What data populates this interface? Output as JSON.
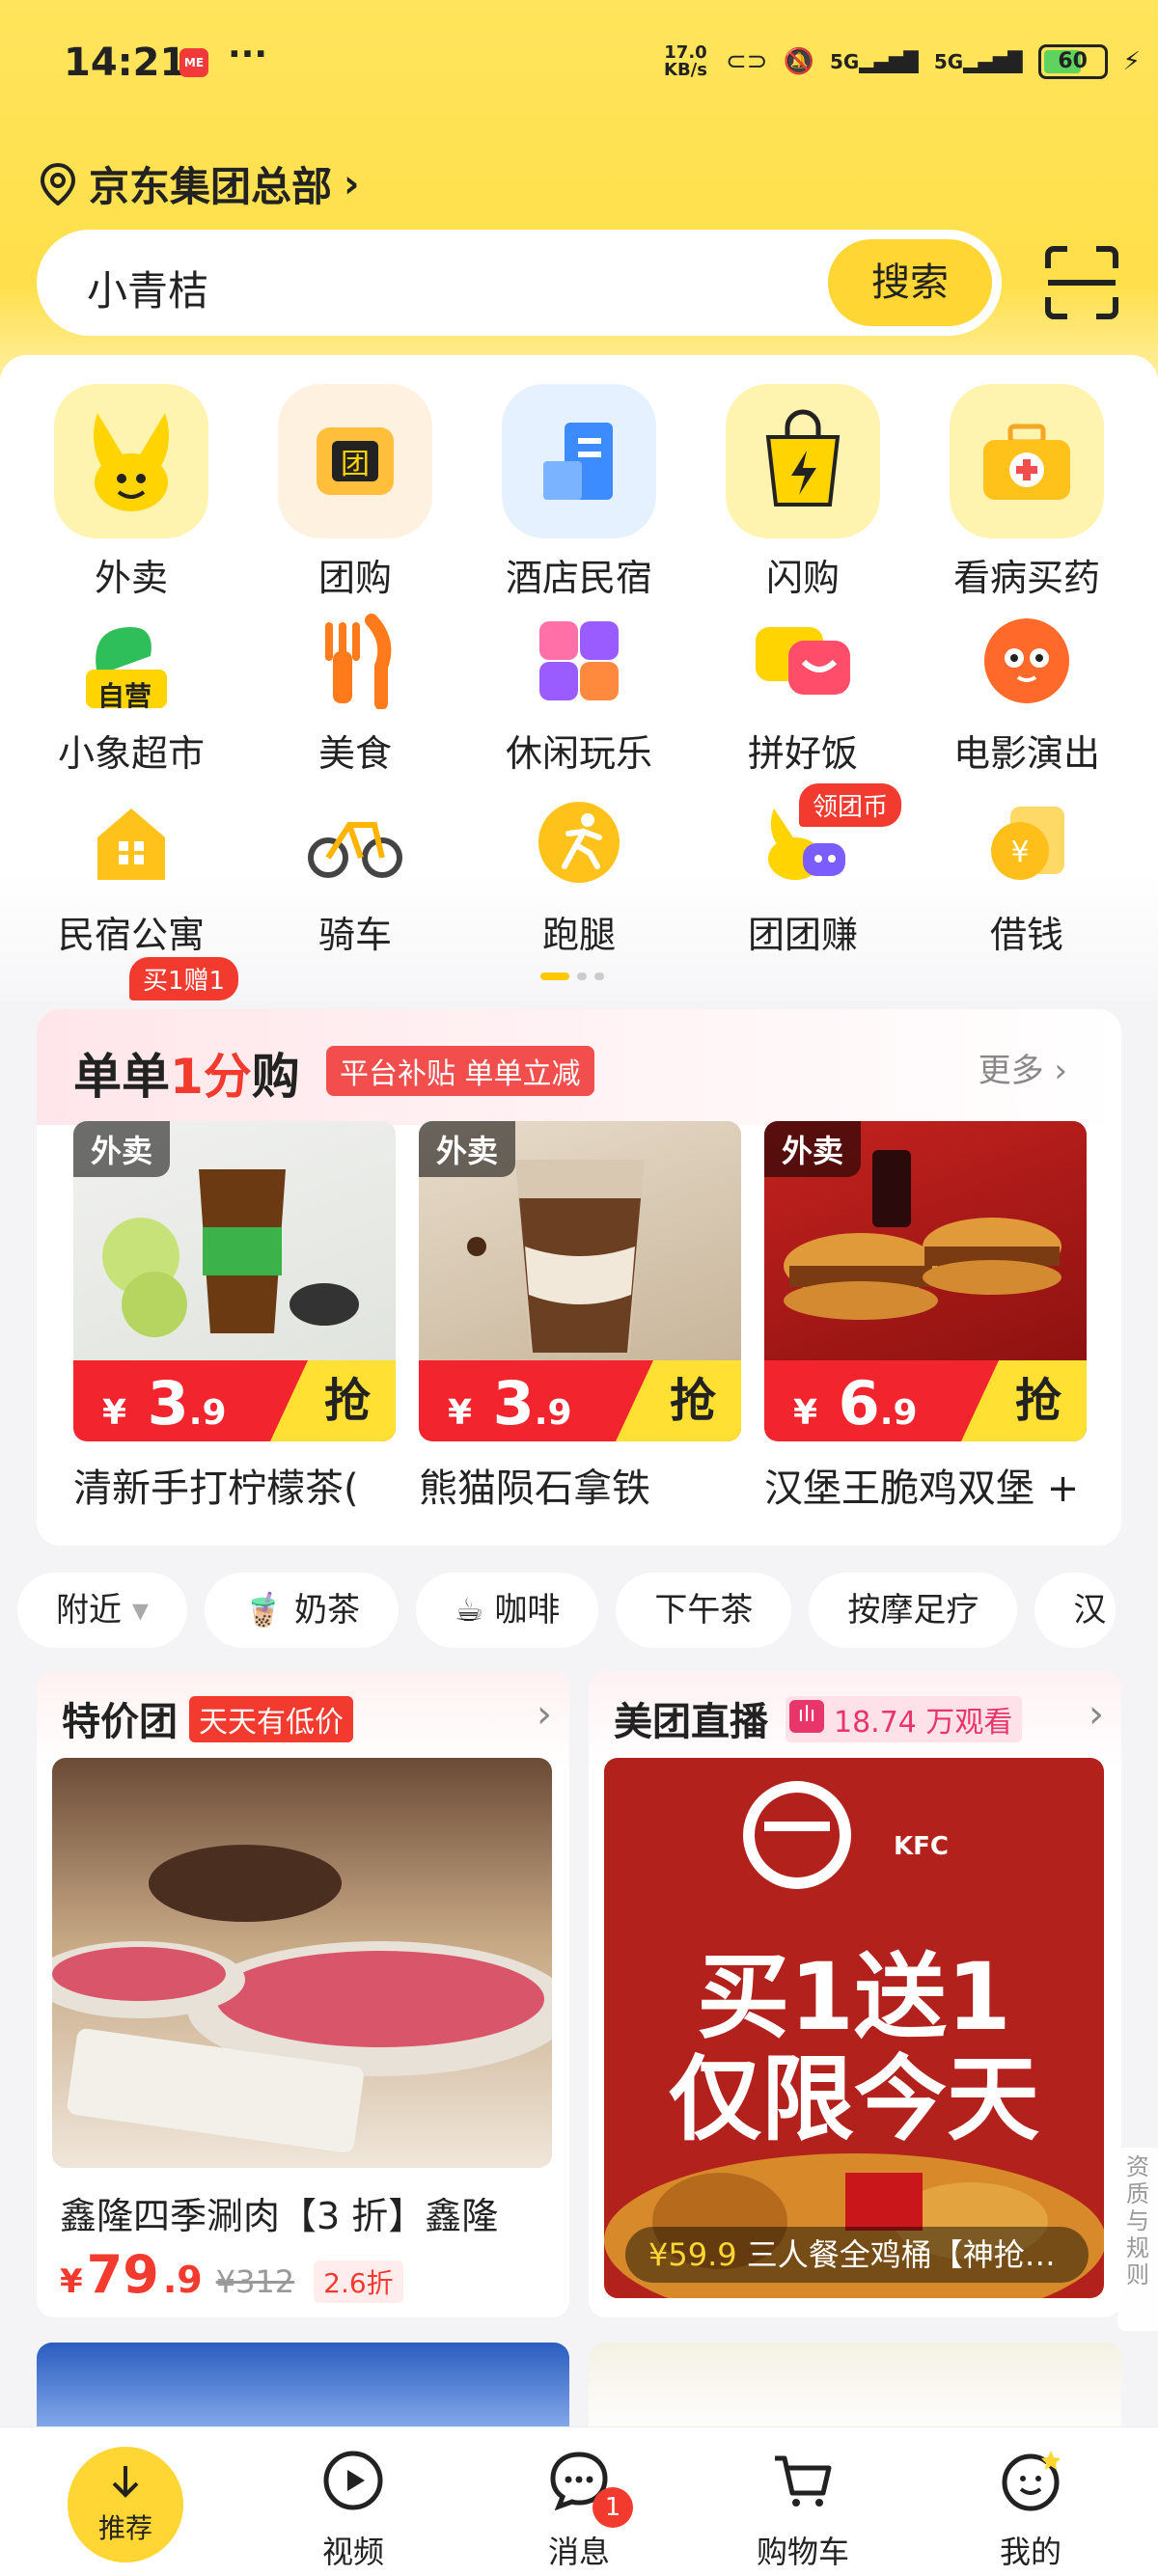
{
  "status_bar": {
    "time": "14:21",
    "netspeed_top": "17.0",
    "netspeed_bottom": "KB/s",
    "battery": "60"
  },
  "header": {
    "location": "京东集团总部"
  },
  "search": {
    "query": "小青桔",
    "button_label": "搜索"
  },
  "categories": [
    {
      "label": "外卖",
      "icon": "waimai-rabbit-icon"
    },
    {
      "label": "团购",
      "icon": "tuangou-icon"
    },
    {
      "label": "酒店民宿",
      "icon": "hotel-icon"
    },
    {
      "label": "闪购",
      "icon": "flash-bag-icon"
    },
    {
      "label": "看病买药",
      "icon": "medicine-box-icon"
    },
    {
      "label": "小象超市",
      "icon": "supermarket-icon",
      "badge": "买1赠1",
      "sub_badge": "自营"
    },
    {
      "label": "美食",
      "icon": "fork-knife-icon"
    },
    {
      "label": "休闲玩乐",
      "icon": "leisure-icon"
    },
    {
      "label": "拼好饭",
      "icon": "pinhaofan-icon"
    },
    {
      "label": "电影演出",
      "icon": "cat-movie-icon"
    },
    {
      "label": "民宿公寓",
      "icon": "house-icon"
    },
    {
      "label": "骑车",
      "icon": "bike-icon"
    },
    {
      "label": "跑腿",
      "icon": "runner-icon"
    },
    {
      "label": "团团赚",
      "icon": "game-icon",
      "badge": "领团币"
    },
    {
      "label": "借钱",
      "icon": "coin-icon"
    }
  ],
  "deal_section": {
    "title_prefix": "单单",
    "title_highlight": "1分",
    "title_suffix": "购",
    "badge": "平台补贴 单单立减",
    "more": "更多",
    "items": [
      {
        "tag": "外卖",
        "price_main": "3",
        "price_dec": ".9",
        "currency": "¥",
        "grab": "抢",
        "name": "清新手打柠檬茶("
      },
      {
        "tag": "外卖",
        "price_main": "3",
        "price_dec": ".9",
        "currency": "¥",
        "grab": "抢",
        "name": "熊猫陨石拿铁"
      },
      {
        "tag": "外卖",
        "price_main": "6",
        "price_dec": ".9",
        "currency": "¥",
        "grab": "抢",
        "name": "汉堡王脆鸡双堡 +"
      }
    ]
  },
  "filters": [
    "附近",
    "奶茶",
    "咖啡",
    "下午茶",
    "按摩足疗",
    "汉"
  ],
  "feed": {
    "left": {
      "title": "特价团",
      "tag": "天天有低价",
      "item_name": "鑫隆四季涮肉【3 折】鑫隆",
      "price_symbol": "¥",
      "price_main": "79",
      "price_dec": ".9",
      "original_price": "¥312",
      "discount": "2.6折"
    },
    "right": {
      "title": "美团直播",
      "viewers": "18.74 万观看",
      "poster_line1": "买1送1",
      "poster_line2": "仅限今天",
      "caption_price": "¥59.9",
      "caption_text": "三人餐全鸡桶【神抢…"
    },
    "side_note": "资质与规则"
  },
  "tabbar": [
    {
      "label": "推荐",
      "icon": "down-arrow-icon"
    },
    {
      "label": "视频",
      "icon": "play-icon"
    },
    {
      "label": "消息",
      "icon": "chat-icon",
      "badge": "1"
    },
    {
      "label": "购物车",
      "icon": "cart-icon"
    },
    {
      "label": "我的",
      "icon": "smile-icon"
    }
  ],
  "colors": {
    "brand_yellow": "#ffd633",
    "accent_red": "#f23a2f"
  }
}
